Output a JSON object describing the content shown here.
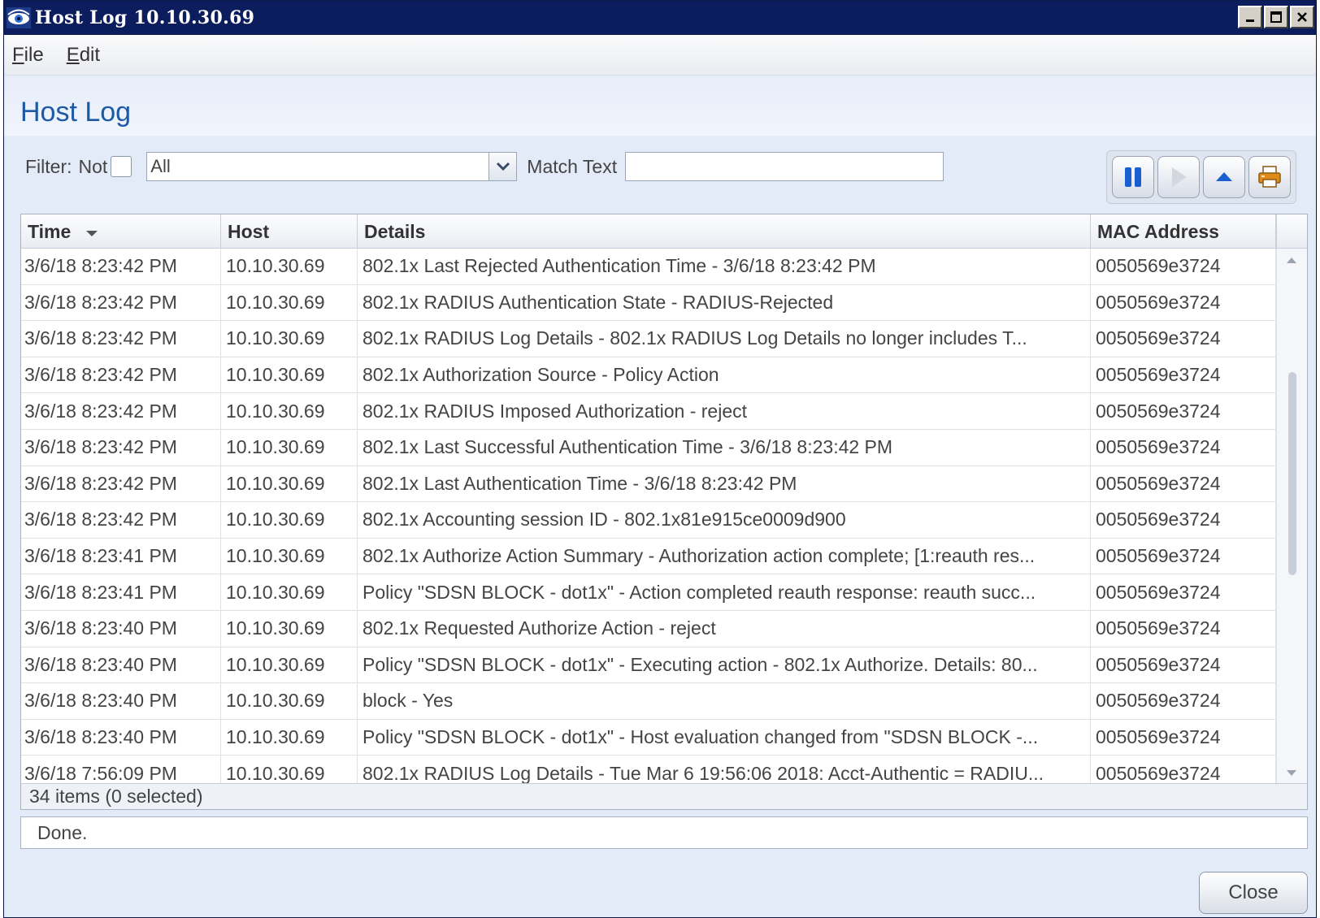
{
  "window": {
    "title": "Host Log 10.10.30.69",
    "icon": "eye-icon"
  },
  "menu": {
    "file": {
      "first": "F",
      "rest": "ile"
    },
    "edit": {
      "first": "E",
      "rest": "dit"
    }
  },
  "page": {
    "title": "Host Log"
  },
  "filter": {
    "label": "Filter:",
    "not_label": "Not",
    "not_checked": false,
    "selected": "All",
    "match_label": "Match Text",
    "match_value": ""
  },
  "toolbar": {
    "pause": "pause-icon",
    "play": "play-icon",
    "up": "arrow-up-icon",
    "print": "print-icon"
  },
  "table": {
    "columns": [
      "Time",
      "Host",
      "Details",
      "MAC Address"
    ],
    "sort_column": "Time",
    "rows": [
      [
        "3/6/18 8:23:42 PM",
        "10.10.30.69",
        "802.1x Last Rejected Authentication Time - 3/6/18 8:23:42 PM",
        "0050569e3724"
      ],
      [
        "3/6/18 8:23:42 PM",
        "10.10.30.69",
        "802.1x RADIUS Authentication State - RADIUS-Rejected",
        "0050569e3724"
      ],
      [
        "3/6/18 8:23:42 PM",
        "10.10.30.69",
        "802.1x RADIUS Log Details - 802.1x RADIUS Log Details no longer includes T...",
        "0050569e3724"
      ],
      [
        "3/6/18 8:23:42 PM",
        "10.10.30.69",
        "802.1x Authorization Source - Policy Action",
        "0050569e3724"
      ],
      [
        "3/6/18 8:23:42 PM",
        "10.10.30.69",
        "802.1x RADIUS Imposed Authorization - reject",
        "0050569e3724"
      ],
      [
        "3/6/18 8:23:42 PM",
        "10.10.30.69",
        "802.1x Last Successful Authentication Time - 3/6/18 8:23:42 PM",
        "0050569e3724"
      ],
      [
        "3/6/18 8:23:42 PM",
        "10.10.30.69",
        "802.1x Last Authentication Time - 3/6/18 8:23:42 PM",
        "0050569e3724"
      ],
      [
        "3/6/18 8:23:42 PM",
        "10.10.30.69",
        "802.1x Accounting session ID - 802.1x81e915ce0009d900",
        "0050569e3724"
      ],
      [
        "3/6/18 8:23:41 PM",
        "10.10.30.69",
        "802.1x Authorize Action Summary - Authorization action complete;  [1:reauth res...",
        "0050569e3724"
      ],
      [
        "3/6/18 8:23:41 PM",
        "10.10.30.69",
        "Policy \"SDSN BLOCK - dot1x\"  - Action completed reauth response: reauth succ...",
        "0050569e3724"
      ],
      [
        "3/6/18 8:23:40 PM",
        "10.10.30.69",
        "802.1x Requested Authorize Action - reject",
        "0050569e3724"
      ],
      [
        "3/6/18 8:23:40 PM",
        "10.10.30.69",
        "Policy \"SDSN BLOCK - dot1x\"  - Executing action - 802.1x Authorize. Details: 80...",
        "0050569e3724"
      ],
      [
        "3/6/18 8:23:40 PM",
        "10.10.30.69",
        "block - Yes",
        "0050569e3724"
      ],
      [
        "3/6/18 8:23:40 PM",
        "10.10.30.69",
        "Policy \"SDSN BLOCK - dot1x\"  - Host evaluation changed from \"SDSN BLOCK -...",
        "0050569e3724"
      ],
      [
        "3/6/18 7:56:09 PM",
        "10.10.30.69",
        "802.1x RADIUS Log Details - Tue Mar  6 19:56:06 2018: Acct-Authentic = RADIU...",
        "0050569e3724"
      ]
    ],
    "footer": "34 items (0 selected)"
  },
  "status": {
    "text": "Done."
  },
  "buttons": {
    "close": "Close"
  },
  "colors": {
    "titlebar": "#0c1d5e",
    "heading": "#1d5aa6",
    "background": "#e4ebf8",
    "pause_blue": "#1a5fd0",
    "print_orange": "#e08a1a"
  }
}
